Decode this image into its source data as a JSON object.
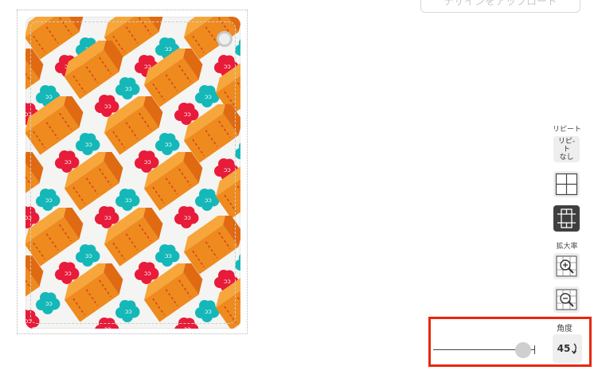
{
  "top_button": {
    "label": "デザインをアップロード"
  },
  "side_panel": {
    "repeat_title": "リピート",
    "repeat_none_label": "リピ-\nト\nなし",
    "zoom_title": "拡大率"
  },
  "angle_panel": {
    "title": "角度",
    "value_label": "45",
    "slider_value_fraction": 0.85,
    "highlight_color": "#e8270e"
  },
  "colors": {
    "box_orange": "#ee8a1e",
    "box_orange_dark": "#e06a12",
    "cloud_teal": "#15b8b8",
    "cloud_red": "#e81b3a",
    "card_bg": "#f4f4f3"
  }
}
